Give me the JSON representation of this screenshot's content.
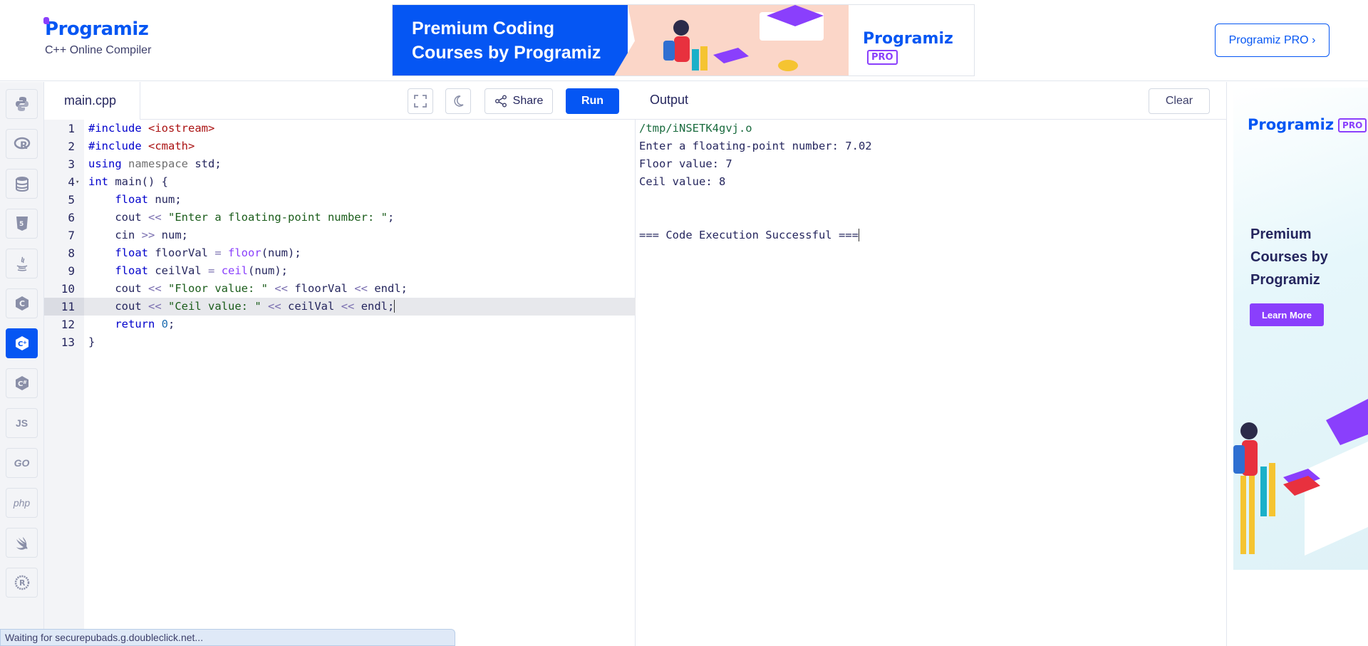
{
  "brand": {
    "logo_text": "rogramiz",
    "logo_initial": "P",
    "subtitle": "C++ Online Compiler"
  },
  "banner": {
    "title_line1": "Premium Coding",
    "title_line2": "Courses by Programiz",
    "logo": "Programiz",
    "pro": "PRO"
  },
  "header": {
    "pro_button": "Programiz PRO ›"
  },
  "sidebar": {
    "languages": [
      "python-icon",
      "r-icon",
      "sql-icon",
      "html-icon",
      "java-icon",
      "c-icon",
      "cpp-icon",
      "csharp-icon",
      "js-icon",
      "go-icon",
      "php-icon",
      "swift-icon",
      "rust-icon"
    ],
    "labels": {
      "js": "JS",
      "go": "GO",
      "php": "php"
    },
    "active": "cpp-icon"
  },
  "editor": {
    "tab": "main.cpp",
    "share_label": "Share",
    "run_label": "Run",
    "line_numbers": [
      "1",
      "2",
      "3",
      "4",
      "5",
      "6",
      "7",
      "8",
      "9",
      "10",
      "11",
      "12",
      "13"
    ],
    "current_line": 11
  },
  "output": {
    "title": "Output",
    "clear_label": "Clear",
    "lines": [
      "/tmp/iNSETK4gvj.o",
      "Enter a floating-point number: 7.02",
      "Floor value: 7",
      "Ceil value: 8",
      "",
      "",
      "=== Code Execution Successful ==="
    ]
  },
  "side_ad": {
    "logo": "Programiz",
    "pro": "PRO",
    "headline": "Premium Courses by Programiz",
    "cta": "Learn More"
  },
  "status_bar": {
    "text": "Waiting for securepubads.g.doubleclick.net..."
  },
  "colors": {
    "accent": "#0556f3",
    "purple": "#8a3ffc"
  }
}
